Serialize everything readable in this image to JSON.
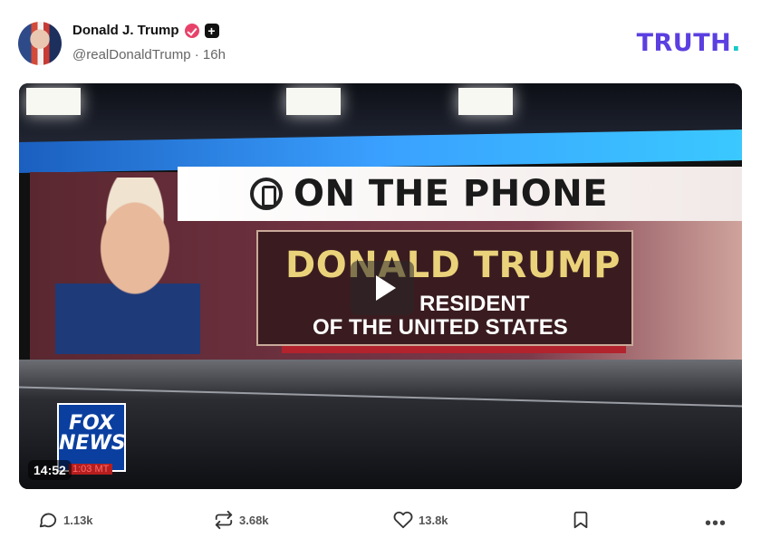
{
  "post": {
    "author_name": "Donald J. Trump",
    "handle_time": "@realDonaldTrump · 16h",
    "brand": "TRUTH",
    "brand_dot": ".",
    "icons": [
      "verified-badge-icon",
      "plus-badge-icon"
    ]
  },
  "media": {
    "banner": "ON THE PHONE",
    "name_line": "DONALD TRUMP",
    "title_line1": "RESIDENT",
    "title_line2": "OF THE UNITED STATES",
    "network": "FOX NEWS",
    "network_line1": "FOX",
    "network_line2": "NEWS",
    "clock": "1:03 MT",
    "duration": "14:52",
    "play_icon": "play-icon"
  },
  "actions": {
    "reply_count": "1.13k",
    "retruth_count": "3.68k",
    "like_count": "13.8k",
    "more_label": "•••",
    "icons": [
      "reply-icon",
      "retruth-icon",
      "like-icon",
      "bookmark-icon",
      "more-icon"
    ]
  },
  "colors": {
    "brand": "#5b3fe0",
    "brand_dot": "#18c8c8",
    "verified": "#e8426a"
  }
}
